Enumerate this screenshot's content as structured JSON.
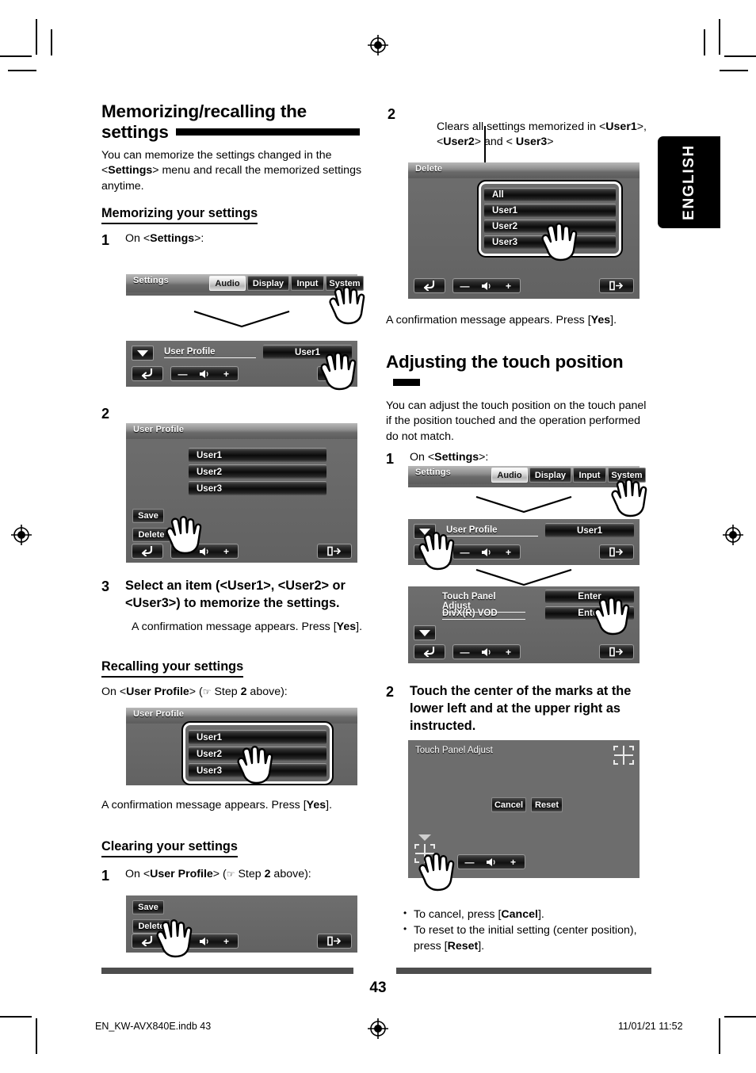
{
  "page": {
    "number": "43",
    "language_tab": "ENGLISH",
    "footer_file": "EN_KW-AVX840E.indb   43",
    "footer_date": "11/01/21   11:52"
  },
  "left_column": {
    "section_title": "Memorizing/recalling the settings",
    "intro_parts": {
      "a": "You can memorize the settings changed in the <",
      "b": "Settings",
      "c": "> menu and recall the memorized settings anytime."
    },
    "memorizing": {
      "heading": "Memorizing your settings",
      "step1_num": "1",
      "step1_prefix": "On <",
      "step1_bold": "Settings",
      "step1_suffix": ">:",
      "step2_num": "2",
      "step3_num": "3",
      "step3_text_a": "Select an item (<User1>, <User2> or <User3>) to memorize the settings.",
      "step3_note_a": "A confirmation message appears. Press [",
      "step3_note_b": "Yes",
      "step3_note_c": "]."
    },
    "recalling": {
      "heading": "Recalling your settings",
      "lead_a": "On <",
      "lead_b": "User Profile",
      "lead_c": "> (",
      "lead_d": " Step ",
      "lead_e": "2",
      "lead_f": " above):",
      "note_a": "A confirmation message appears. Press [",
      "note_b": "Yes",
      "note_c": "]."
    },
    "clearing": {
      "heading": "Clearing your settings",
      "step1_num": "1",
      "lead_a": "On <",
      "lead_b": "User Profile",
      "lead_c": "> (",
      "lead_d": " Step ",
      "lead_e": "2",
      "lead_f": " above):"
    }
  },
  "right_column": {
    "step2_num": "2",
    "callout_a": "Clears all settings memorized in <",
    "callout_b": "User1",
    "callout_c": ">, <",
    "callout_d": "User2",
    "callout_e": "> and < ",
    "callout_f": "User3",
    "callout_g": ">",
    "confirm_a": "A confirmation message appears. Press [",
    "confirm_b": "Yes",
    "confirm_c": "].",
    "section_title": "Adjusting the touch position",
    "intro": "You can adjust the touch position on the touch panel if the position touched and the operation performed do not match.",
    "step1_num": "1",
    "step1_prefix": "On <",
    "step1_bold": "Settings",
    "step1_suffix": ">:",
    "step2b_num": "2",
    "step2b_text": "Touch the center of the marks at the lower left and at the upper right as instructed.",
    "bullets": [
      {
        "a": "To cancel, press [",
        "b": "Cancel",
        "c": "]."
      },
      {
        "a": "To reset to the initial setting (center position), press [",
        "b": "Reset",
        "c": "]."
      }
    ]
  },
  "screens": {
    "settings_bar": {
      "title": "Settings",
      "tabs": [
        {
          "label": "Audio",
          "selected": true
        },
        {
          "label": "Display",
          "selected": false
        },
        {
          "label": "Input",
          "selected": false
        },
        {
          "label": "System",
          "selected": false
        }
      ]
    },
    "user_profile_row": {
      "label": "User Profile",
      "value": "User1"
    },
    "user_profile_list": {
      "title": "User Profile",
      "items": [
        "User1",
        "User2",
        "User3"
      ],
      "save": "Save",
      "delete": "Delete"
    },
    "delete_list": {
      "title": "Delete",
      "items": [
        "All",
        "User1",
        "User2",
        "User3"
      ]
    },
    "touch_menu": {
      "rows": [
        {
          "label": "Touch Panel Adjust",
          "value": "Enter"
        },
        {
          "label": "DivX(R) VOD",
          "value": "Enter"
        }
      ]
    },
    "touch_adjust": {
      "title": "Touch Panel Adjust",
      "cancel": "Cancel",
      "reset": "Reset"
    }
  },
  "colors": {
    "device_bg": "#686868",
    "ink": "#000000",
    "rule": "#4d4d4d"
  }
}
